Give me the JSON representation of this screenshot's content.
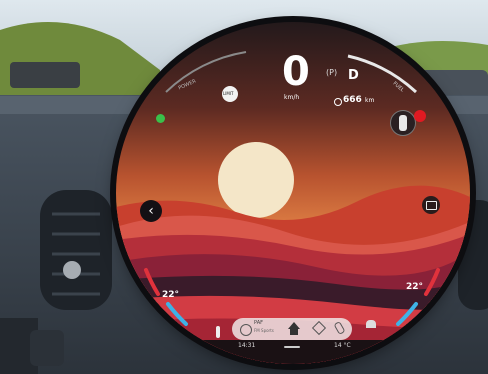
{
  "speed": {
    "value": "0",
    "unit": "km/h"
  },
  "gear": {
    "parking": "(P)",
    "current": "D"
  },
  "power_label": "POWER",
  "fuel_label": "FUEL",
  "range": {
    "value": "666",
    "unit": "km"
  },
  "limit_label": "LIMIT",
  "climate": {
    "left_temp": "22°",
    "right_temp": "22°"
  },
  "bottom": {
    "time": "14:31",
    "outside_temp": "14 °C",
    "radio_name": "PAF",
    "radio_sub": "FM Sports"
  },
  "icons": [
    "back-arrow-icon",
    "car-icon",
    "screen-toggle-icon",
    "seat-heat-icon",
    "home-icon",
    "navigation-icon",
    "phone-icon",
    "media-icon"
  ],
  "colors": {
    "sky_top": "#c9542d",
    "sun": "#f4e6c8",
    "cold_arc": "#3fb3e6",
    "hot_arc": "#e0323c"
  }
}
